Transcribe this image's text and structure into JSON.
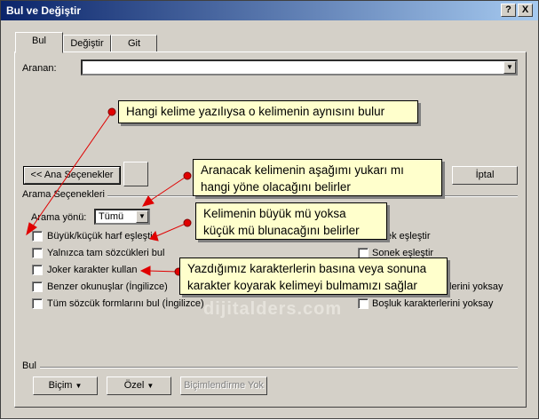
{
  "window": {
    "title": "Bul ve Değiştir",
    "help_btn": "?",
    "close_btn": "X"
  },
  "tabs": [
    "Bul",
    "Değiştir",
    "Git"
  ],
  "search": {
    "label": "Aranan:",
    "value": ""
  },
  "buttons": {
    "less": "<< Ana Seçenekler",
    "cancel": "İptal",
    "format": "Biçim",
    "special": "Özel",
    "no_format": "Biçimlendirme Yok"
  },
  "options_title": "Arama Seçenekleri",
  "direction": {
    "label": "Arama yönü:",
    "value": "Tümü"
  },
  "left_options": [
    "Büyük/küçük harf eşleştir",
    "Yalnızca tam sözcükleri bul",
    "Joker karakter kullan",
    "Benzer okunuşlar (İngilizce)",
    "Tüm sözcük formlarını bul (İngilizce)"
  ],
  "right_options": [
    "ek eşleştir",
    "Sonek eşleştir",
    "lerini yoksay",
    "Boşluk karakterlerini yoksay"
  ],
  "bottom_section": "Bul",
  "watermark": "dijitalders.com",
  "callouts": [
    "Hangi kelime yazılıysa o kelimenin aynısını bulur",
    "Aranacak kelimenin aşağımı yukarı mı hangi yöne olacağını belirler",
    "Kelimenin büyük mü yoksa küçük mü blunacağını belirler",
    "Yazdığımız karakterlerin basına veya sonuna karakter koyarak kelimeyi bulmamızı sağlar"
  ]
}
